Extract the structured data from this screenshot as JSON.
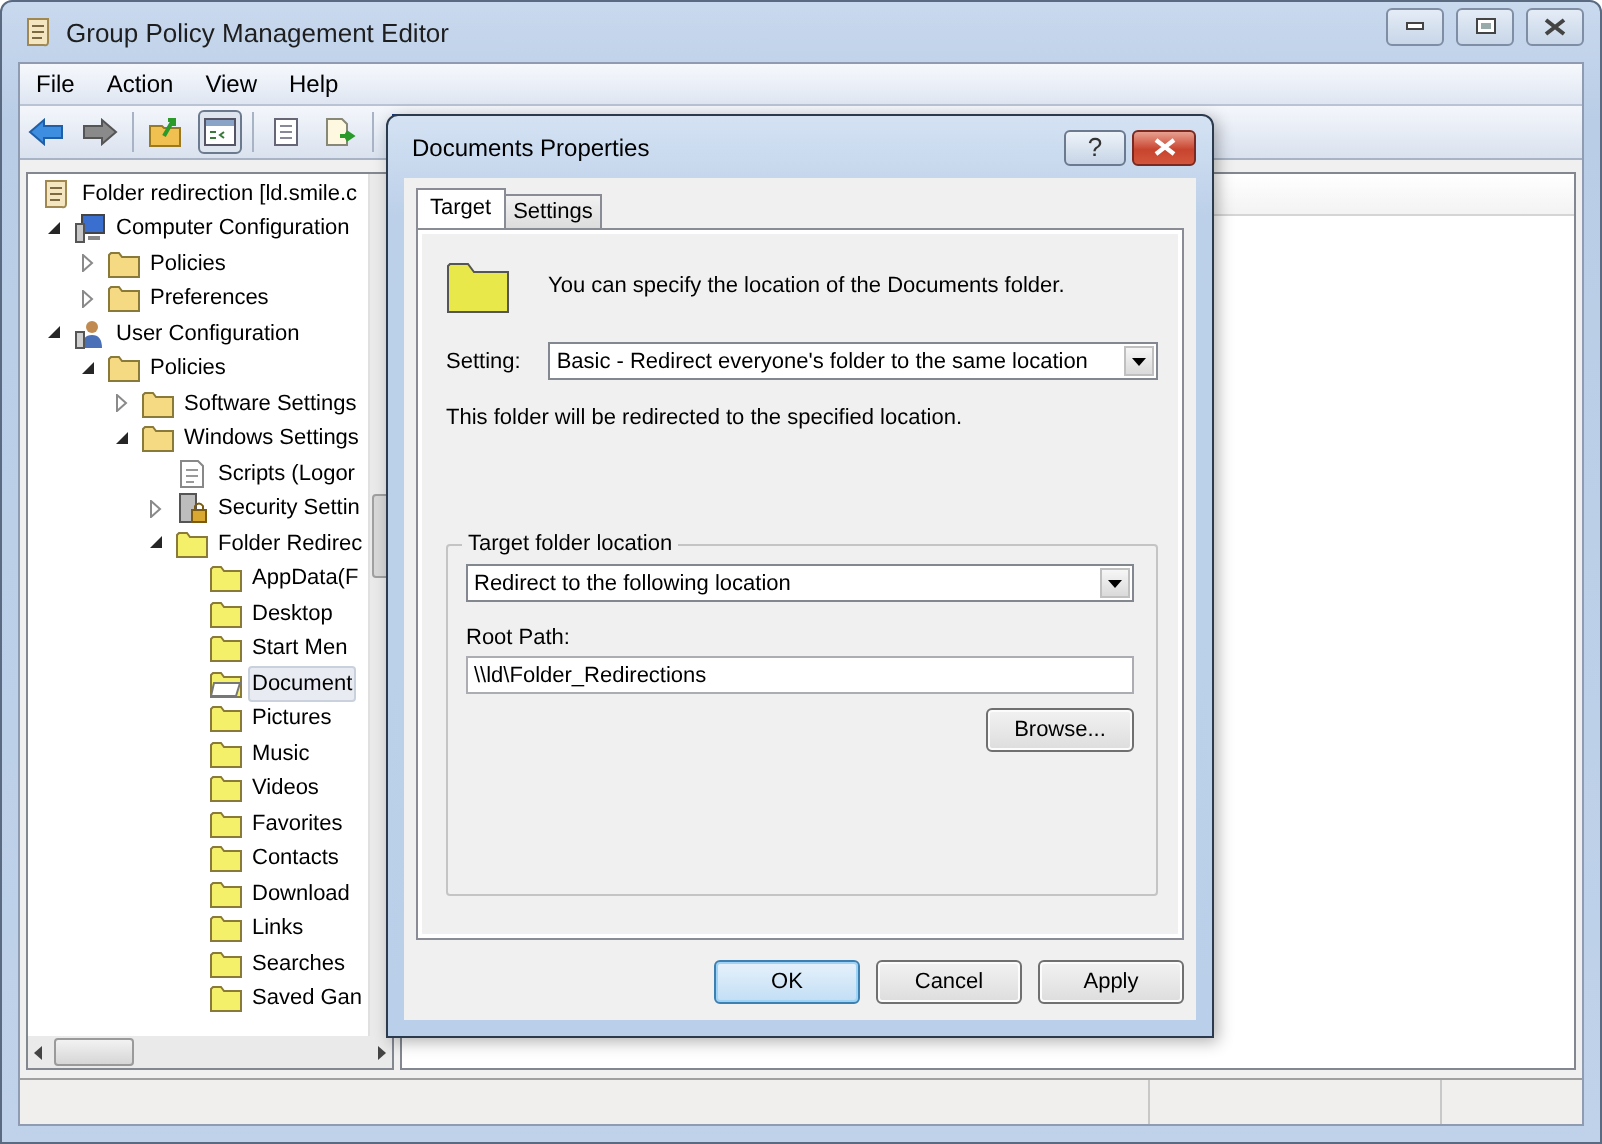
{
  "window": {
    "title": "Group Policy Management Editor"
  },
  "menu": [
    "File",
    "Action",
    "View",
    "Help"
  ],
  "tree": {
    "items": [
      {
        "kind": "policy",
        "label": "Folder redirection [ld.smile.c",
        "selected": false,
        "children": [
          {
            "kind": "computer",
            "label": "Computer Configuration",
            "selected": false,
            "expanded": true,
            "children": [
              {
                "kind": "folder",
                "label": "Policies",
                "selected": false,
                "expanded": false
              },
              {
                "kind": "folder",
                "label": "Preferences",
                "selected": false,
                "expanded": false
              }
            ]
          },
          {
            "kind": "user",
            "label": "User Configuration",
            "selected": false,
            "expanded": true,
            "children": [
              {
                "kind": "folder",
                "label": "Policies",
                "selected": false,
                "expanded": true,
                "children": [
                  {
                    "kind": "folder",
                    "label": "Software Settings",
                    "selected": false,
                    "expanded": false
                  },
                  {
                    "kind": "folder",
                    "label": "Windows Settings",
                    "selected": false,
                    "expanded": true,
                    "children": [
                      {
                        "kind": "script",
                        "label": "Scripts (Logor",
                        "selected": false
                      },
                      {
                        "kind": "security",
                        "label": "Security Settin",
                        "selected": false,
                        "expanded": false
                      },
                      {
                        "kind": "redirect",
                        "label": "Folder Redirec",
                        "selected": false,
                        "expanded": true,
                        "children": [
                          {
                            "kind": "redirect",
                            "label": "AppData(F",
                            "selected": false
                          },
                          {
                            "kind": "redirect",
                            "label": "Desktop",
                            "selected": false
                          },
                          {
                            "kind": "redirect",
                            "label": "Start Men",
                            "selected": false
                          },
                          {
                            "kind": "redirect",
                            "label": "Document",
                            "selected": true
                          },
                          {
                            "kind": "redirect",
                            "label": "Pictures",
                            "selected": false
                          },
                          {
                            "kind": "redirect",
                            "label": "Music",
                            "selected": false
                          },
                          {
                            "kind": "redirect",
                            "label": "Videos",
                            "selected": false
                          },
                          {
                            "kind": "redirect",
                            "label": "Favorites",
                            "selected": false
                          },
                          {
                            "kind": "redirect",
                            "label": "Contacts",
                            "selected": false
                          },
                          {
                            "kind": "redirect",
                            "label": "Download",
                            "selected": false
                          },
                          {
                            "kind": "redirect",
                            "label": "Links",
                            "selected": false
                          },
                          {
                            "kind": "redirect",
                            "label": "Searches",
                            "selected": false
                          },
                          {
                            "kind": "redirect",
                            "label": "Saved Gan",
                            "selected": false
                          }
                        ]
                      }
                    ]
                  }
                ]
              }
            ]
          }
        ]
      }
    ]
  },
  "dialog": {
    "title": "Documents Properties",
    "help_button": "?",
    "tabs": [
      {
        "label": "Target",
        "selected": true
      },
      {
        "label": "Settings",
        "selected": false
      }
    ],
    "description": "You can specify the location of the Documents folder.",
    "setting": {
      "label": "Setting:",
      "value": "Basic - Redirect everyone's folder to the same location"
    },
    "note": "This folder will be redirected to the specified location.",
    "group": {
      "legend": "Target folder location",
      "location": "Redirect to the following location",
      "root_path": {
        "label": "Root Path:",
        "value": "\\\\ld\\Folder_Redirections"
      },
      "browse": "Browse..."
    },
    "buttons": [
      {
        "label": "OK",
        "default": true
      },
      {
        "label": "Cancel",
        "default": false
      },
      {
        "label": "Apply",
        "default": false
      }
    ]
  }
}
